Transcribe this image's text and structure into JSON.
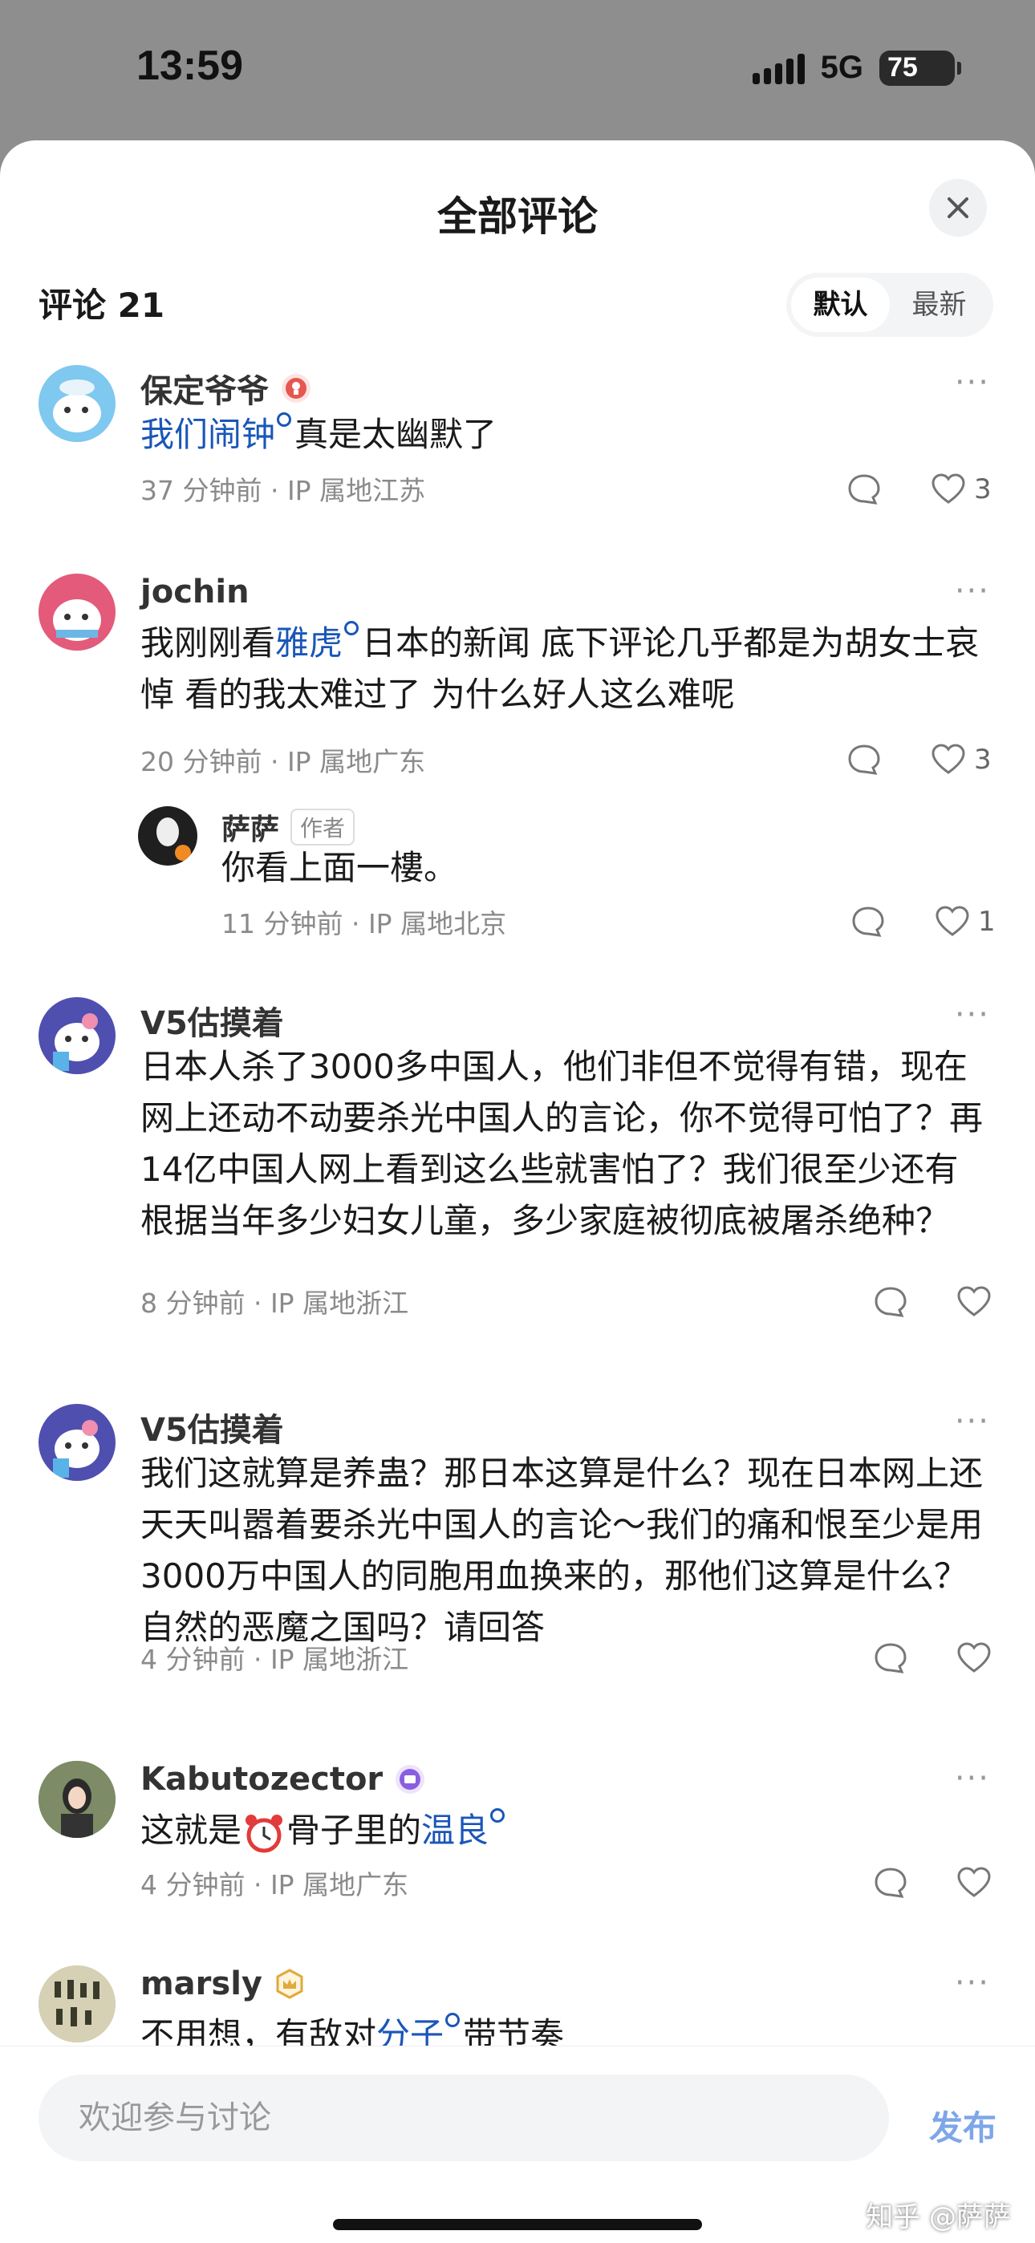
{
  "status": {
    "time": "13:59",
    "network": "5G",
    "battery": "75"
  },
  "header": {
    "title": "全部评论",
    "count_label": "评论 21",
    "sort_default": "默认",
    "sort_latest": "最新"
  },
  "comments": [
    {
      "name": "保定爷爷",
      "text_link": "我们闹钟",
      "text_rest": "真是太幽默了",
      "meta": "37 分钟前 · IP 属地江苏",
      "likes": "3"
    },
    {
      "name": "jochin",
      "text_pre": "我刚刚看",
      "text_link": "雅虎",
      "text_rest": "日本的新闻 底下评论几乎都是为胡女士哀悼 看的我太难过了 为什么好人这么难呢",
      "meta": "20 分钟前 · IP 属地广东",
      "likes": "3"
    },
    {
      "name": "萨萨",
      "badge": "作者",
      "text": "你看上面一樓。",
      "meta": "11 分钟前 · IP 属地北京",
      "likes": "1"
    },
    {
      "name": "V5估摸着",
      "text": "日本人杀了3000多中国人，他们非但不觉得有错，现在网上还动不动要杀光中国人的言论，你不觉得可怕了？再14亿中国人网上看到这么些就害怕了？我们很至少还有根据当年多少妇女儿童，多少家庭被彻底被屠杀绝种？",
      "meta": "8 分钟前 · IP 属地浙江"
    },
    {
      "name": "V5估摸着",
      "text": "我们这就算是养蛊？那日本这算是什么？现在日本网上还天天叫嚣着要杀光中国人的言论～我们的痛和恨至少是用3000万中国人的同胞用血换来的，那他们这算是什么？自然的恶魔之国吗？请回答",
      "meta": "4 分钟前 · IP 属地浙江"
    },
    {
      "name": "Kabutozector",
      "text_pre": "这就是",
      "text_mid": "骨子里的",
      "text_link": "温良",
      "meta": "4 分钟前 · IP 属地广东"
    },
    {
      "name": "marsly",
      "text_pre": "不用想，有敌对",
      "text_link": "分子",
      "text_rest": "带节奏"
    }
  ],
  "composer": {
    "placeholder": "欢迎参与讨论",
    "publish": "发布"
  },
  "watermark": "知乎 @萨萨"
}
